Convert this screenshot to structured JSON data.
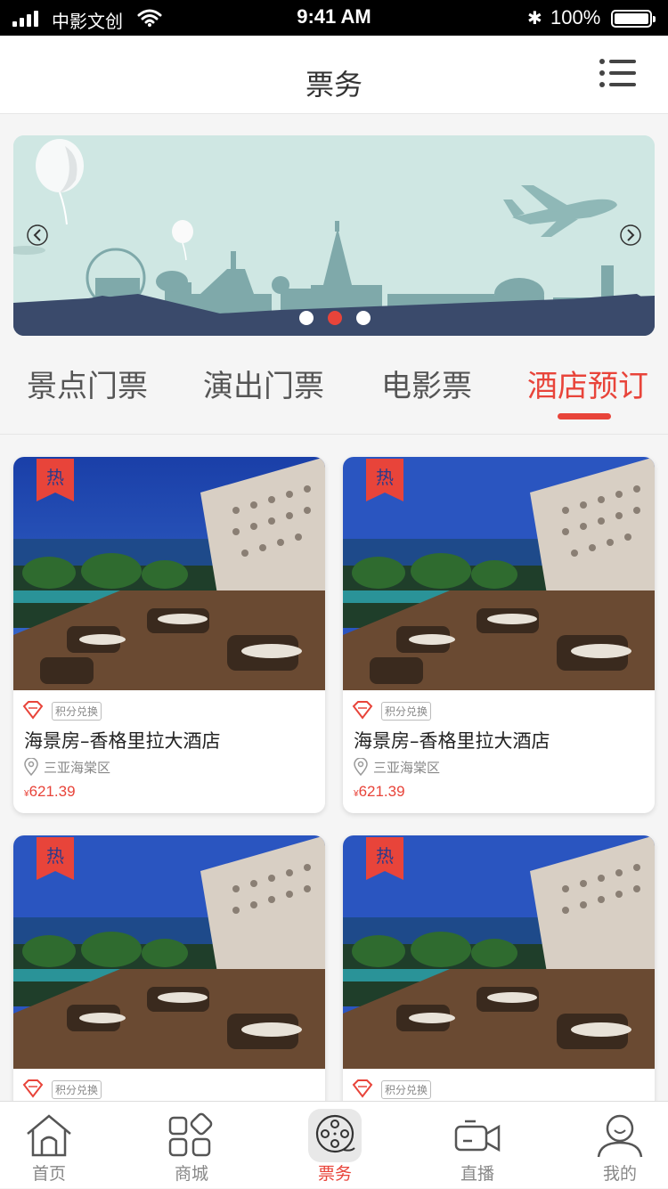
{
  "status_bar": {
    "carrier": "中影文创",
    "time": "9:41 AM",
    "battery": "100%"
  },
  "header": {
    "title": "票务"
  },
  "banner": {
    "page_count": 3,
    "active_page": 2
  },
  "category_tabs": [
    {
      "label": "景点门票",
      "active": false
    },
    {
      "label": "演出门票",
      "active": false
    },
    {
      "label": "电影票",
      "active": false
    },
    {
      "label": "酒店预订",
      "active": true
    }
  ],
  "products": [
    {
      "badge": "热",
      "tag": "积分兑换",
      "name": "海景房–香格里拉大酒店",
      "location": "三亚海棠区",
      "currency": "¥",
      "price": "621.39"
    },
    {
      "badge": "热",
      "tag": "积分兑换",
      "name": "海景房–香格里拉大酒店",
      "location": "三亚海棠区",
      "currency": "¥",
      "price": "621.39"
    },
    {
      "badge": "热",
      "tag": "积分兑换",
      "name": "",
      "location": "",
      "currency": "",
      "price": ""
    },
    {
      "badge": "热",
      "tag": "积分兑换",
      "name": "",
      "location": "",
      "currency": "",
      "price": ""
    }
  ],
  "bottom_nav": [
    {
      "label": "首页",
      "icon": "home-icon",
      "active": false
    },
    {
      "label": "商城",
      "icon": "grid-icon",
      "active": false
    },
    {
      "label": "票务",
      "icon": "film-reel-icon",
      "active": true
    },
    {
      "label": "直播",
      "icon": "video-camera-icon",
      "active": false
    },
    {
      "label": "我的",
      "icon": "user-icon",
      "active": false
    }
  ],
  "colors": {
    "accent": "#e8443a",
    "banner_sky": "#cde6e2",
    "banner_ground": "#3a4a6b"
  }
}
